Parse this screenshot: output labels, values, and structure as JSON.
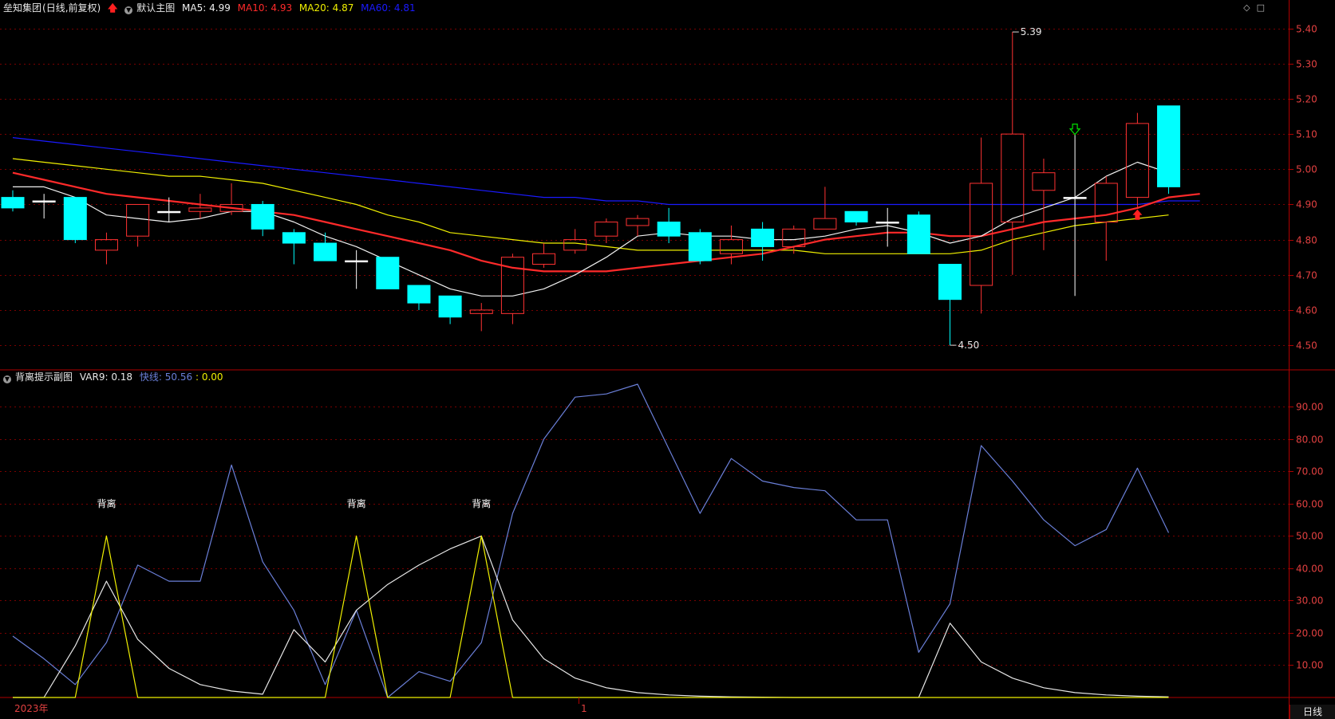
{
  "top_panel": {
    "title": "垒知集团",
    "mode": "(日线,前复权)",
    "template": "默认主图",
    "ma": [
      {
        "label": "MA5:",
        "value": "4.99",
        "color": "#f0f0f0"
      },
      {
        "label": "MA10:",
        "value": "4.93",
        "color": "#ff2a2a"
      },
      {
        "label": "MA20:",
        "value": "4.87",
        "color": "#f0f000"
      },
      {
        "label": "MA60:",
        "value": "4.81",
        "color": "#1a1aff"
      }
    ]
  },
  "sub_panel": {
    "title": "背离提示副图",
    "var_label": "VAR9:",
    "var_value": "0.18",
    "fast_label": "快线:",
    "fast_value": "50.56",
    "sep": ":",
    "yellow_value": "0.00"
  },
  "icons": [
    "diamond-icon",
    "square-icon"
  ],
  "bottom": {
    "year_label": "2023年",
    "month_label": "1",
    "period_label": "日线"
  },
  "colors": {
    "grid": "#7a0000",
    "up": "#ff3232",
    "down": "#00ffff",
    "ma5": "#f0f0f0",
    "ma10": "#ff2a2a",
    "ma20": "#f0f000",
    "ma60": "#1a1aff",
    "fast": "#6a7fd8",
    "slow": "#e8e8e8",
    "yellow": "#f0f000"
  },
  "chart_data": [
    {
      "type": "candlestick",
      "ylim": [
        4.43,
        5.44
      ],
      "yticks": [
        "5.40",
        "5.30",
        "5.20",
        "5.10",
        "5.00",
        "4.90",
        "4.80",
        "4.70",
        "4.60",
        "4.50"
      ],
      "annotations": [
        {
          "text": "5.39",
          "index": 32,
          "value": 5.39
        },
        {
          "text": "4.50",
          "index": 30,
          "value": 4.5
        }
      ],
      "candles": [
        [
          4.92,
          4.89,
          4.94,
          4.88
        ],
        [
          4.91,
          4.91,
          4.93,
          4.86
        ],
        [
          4.92,
          4.8,
          4.92,
          4.79
        ],
        [
          4.77,
          4.8,
          4.82,
          4.73
        ],
        [
          4.81,
          4.9,
          4.9,
          4.78
        ],
        [
          4.88,
          4.88,
          4.92,
          4.85
        ],
        [
          4.88,
          4.89,
          4.93,
          4.86
        ],
        [
          4.88,
          4.9,
          4.96,
          4.87
        ],
        [
          4.9,
          4.83,
          4.91,
          4.81
        ],
        [
          4.82,
          4.79,
          4.83,
          4.73
        ],
        [
          4.79,
          4.74,
          4.82,
          4.74
        ],
        [
          4.74,
          4.74,
          4.77,
          4.66
        ],
        [
          4.75,
          4.66,
          4.75,
          4.66
        ],
        [
          4.67,
          4.62,
          4.67,
          4.6
        ],
        [
          4.64,
          4.58,
          4.64,
          4.56
        ],
        [
          4.59,
          4.6,
          4.62,
          4.54
        ],
        [
          4.59,
          4.75,
          4.76,
          4.56
        ],
        [
          4.73,
          4.76,
          4.79,
          4.72
        ],
        [
          4.77,
          4.8,
          4.83,
          4.76
        ],
        [
          4.81,
          4.85,
          4.86,
          4.79
        ],
        [
          4.84,
          4.86,
          4.87,
          4.81
        ],
        [
          4.85,
          4.81,
          4.89,
          4.79
        ],
        [
          4.82,
          4.74,
          4.83,
          4.73
        ],
        [
          4.76,
          4.8,
          4.84,
          4.73
        ],
        [
          4.83,
          4.78,
          4.85,
          4.74
        ],
        [
          4.78,
          4.83,
          4.84,
          4.76
        ],
        [
          4.83,
          4.86,
          4.95,
          4.83
        ],
        [
          4.88,
          4.85,
          4.88,
          4.84
        ],
        [
          4.85,
          4.85,
          4.89,
          4.78
        ],
        [
          4.87,
          4.76,
          4.88,
          4.76
        ],
        [
          4.73,
          4.63,
          4.73,
          4.5
        ],
        [
          4.67,
          4.96,
          5.09,
          4.59
        ],
        [
          4.85,
          5.1,
          5.39,
          4.7
        ],
        [
          4.94,
          4.99,
          5.03,
          4.77
        ],
        [
          4.92,
          4.92,
          5.1,
          4.64
        ],
        [
          4.85,
          4.96,
          4.98,
          4.74
        ],
        [
          4.92,
          5.13,
          5.16,
          4.89
        ],
        [
          5.18,
          4.95,
          5.18,
          4.93
        ]
      ],
      "ma5": [
        4.95,
        4.95,
        4.92,
        4.87,
        4.86,
        4.85,
        4.86,
        4.88,
        4.88,
        4.85,
        4.81,
        4.78,
        4.74,
        4.7,
        4.66,
        4.64,
        4.64,
        4.66,
        4.7,
        4.75,
        4.81,
        4.82,
        4.81,
        4.81,
        4.8,
        4.8,
        4.81,
        4.83,
        4.84,
        4.82,
        4.79,
        4.81,
        4.86,
        4.89,
        4.92,
        4.98,
        5.02,
        4.99
      ],
      "ma10": [
        4.99,
        4.97,
        4.95,
        4.93,
        4.92,
        4.91,
        4.9,
        4.89,
        4.88,
        4.87,
        4.85,
        4.83,
        4.81,
        4.79,
        4.77,
        4.74,
        4.72,
        4.71,
        4.71,
        4.71,
        4.72,
        4.73,
        4.74,
        4.75,
        4.76,
        4.78,
        4.8,
        4.81,
        4.82,
        4.82,
        4.81,
        4.81,
        4.83,
        4.85,
        4.86,
        4.87,
        4.89,
        4.92,
        4.93
      ],
      "ma20": [
        5.03,
        5.02,
        5.01,
        5.0,
        4.99,
        4.98,
        4.98,
        4.97,
        4.96,
        4.94,
        4.92,
        4.9,
        4.87,
        4.85,
        4.82,
        4.81,
        4.8,
        4.79,
        4.79,
        4.78,
        4.77,
        4.77,
        4.77,
        4.77,
        4.77,
        4.77,
        4.76,
        4.76,
        4.76,
        4.76,
        4.76,
        4.77,
        4.8,
        4.82,
        4.84,
        4.85,
        4.86,
        4.87
      ],
      "ma60": [
        5.09,
        5.08,
        5.07,
        5.06,
        5.05,
        5.04,
        5.03,
        5.02,
        5.01,
        5.0,
        4.99,
        4.98,
        4.97,
        4.96,
        4.95,
        4.94,
        4.93,
        4.92,
        4.92,
        4.91,
        4.91,
        4.9,
        4.9,
        4.9,
        4.9,
        4.9,
        4.9,
        4.9,
        4.9,
        4.9,
        4.9,
        4.9,
        4.9,
        4.9,
        4.9,
        4.9,
        4.9,
        4.91,
        4.91
      ],
      "markers": [
        {
          "type": "down-arrow",
          "index": 34,
          "value": 5.11,
          "color": "#00e000"
        },
        {
          "type": "up-arrow",
          "index": 36,
          "value": 4.87,
          "color": "#ff2020"
        }
      ]
    },
    {
      "type": "line",
      "ylim": [
        0,
        97
      ],
      "yticks": [
        "90.00",
        "80.00",
        "70.00",
        "60.00",
        "50.00",
        "40.00",
        "30.00",
        "20.00",
        "10.00"
      ],
      "series": [
        {
          "name": "快线",
          "color": "#6a7fd8",
          "values": [
            19,
            12,
            4,
            17,
            41,
            36,
            36,
            72,
            42,
            27,
            4,
            27,
            0,
            8,
            5,
            17,
            57,
            80,
            93,
            94,
            97,
            77,
            57,
            74,
            67,
            65,
            64,
            55,
            55,
            14,
            29,
            78,
            67,
            55,
            47,
            52,
            71,
            51
          ]
        },
        {
          "name": "VAR9",
          "color": "#e8e8e8",
          "values": [
            0,
            0,
            16,
            36,
            18,
            9,
            4,
            2,
            1,
            21,
            11,
            27,
            35,
            41,
            46,
            50,
            24,
            12,
            6,
            3,
            1.5,
            0.8,
            0.4,
            0.2,
            0.1,
            0,
            0,
            0,
            0,
            0,
            23,
            11,
            6,
            3,
            1.5,
            0.8,
            0.4,
            0.2
          ]
        },
        {
          "name": "yellow",
          "color": "#f0f000",
          "values": [
            0,
            0,
            0,
            50,
            0,
            0,
            0,
            0,
            0,
            0,
            0,
            50,
            0,
            0,
            0,
            50,
            0,
            0,
            0,
            0,
            0,
            0,
            0,
            0,
            0,
            0,
            0,
            0,
            0,
            0,
            0,
            0,
            0,
            0,
            0,
            0,
            0,
            0
          ]
        }
      ],
      "labels": [
        {
          "text": "背离",
          "index": 3
        },
        {
          "text": "背离",
          "index": 11
        },
        {
          "text": "背离",
          "index": 15
        }
      ]
    }
  ]
}
